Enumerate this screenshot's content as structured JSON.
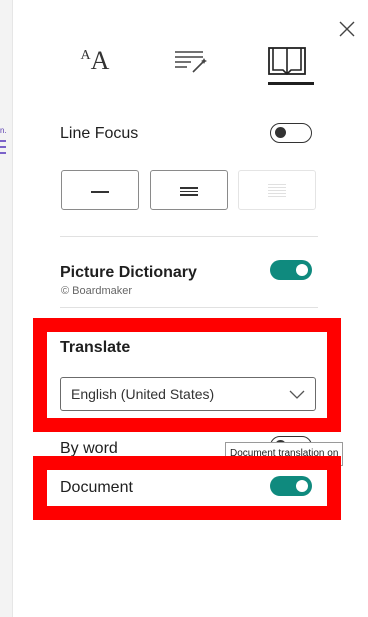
{
  "background_panel": {
    "partial_text": "n."
  },
  "header": {
    "tabs": [
      {
        "name": "text-preferences",
        "icon": "font-size-icon",
        "label_big": "A",
        "label_small": "A"
      },
      {
        "name": "grammar-options",
        "icon": "grammar-wand-icon"
      },
      {
        "name": "reading-preferences",
        "icon": "book-icon",
        "selected": true
      }
    ],
    "close_icon": "close-icon"
  },
  "line_focus": {
    "label": "Line Focus",
    "enabled": false,
    "options": [
      {
        "lines": 1,
        "icon": "one-line-icon"
      },
      {
        "lines": 3,
        "icon": "three-lines-icon"
      },
      {
        "lines": 5,
        "icon": "five-lines-icon",
        "disabled": true
      }
    ]
  },
  "picture_dictionary": {
    "label": "Picture Dictionary",
    "credit": "© Boardmaker",
    "enabled": true
  },
  "translate": {
    "label": "Translate",
    "language": "English (United States)",
    "by_word_label": "By word",
    "by_word_enabled": false,
    "document_label": "Document",
    "document_enabled": true,
    "tooltip": "Document translation on"
  },
  "colors": {
    "accent": "#0f8a7e",
    "highlight_box": "#ff0000"
  }
}
